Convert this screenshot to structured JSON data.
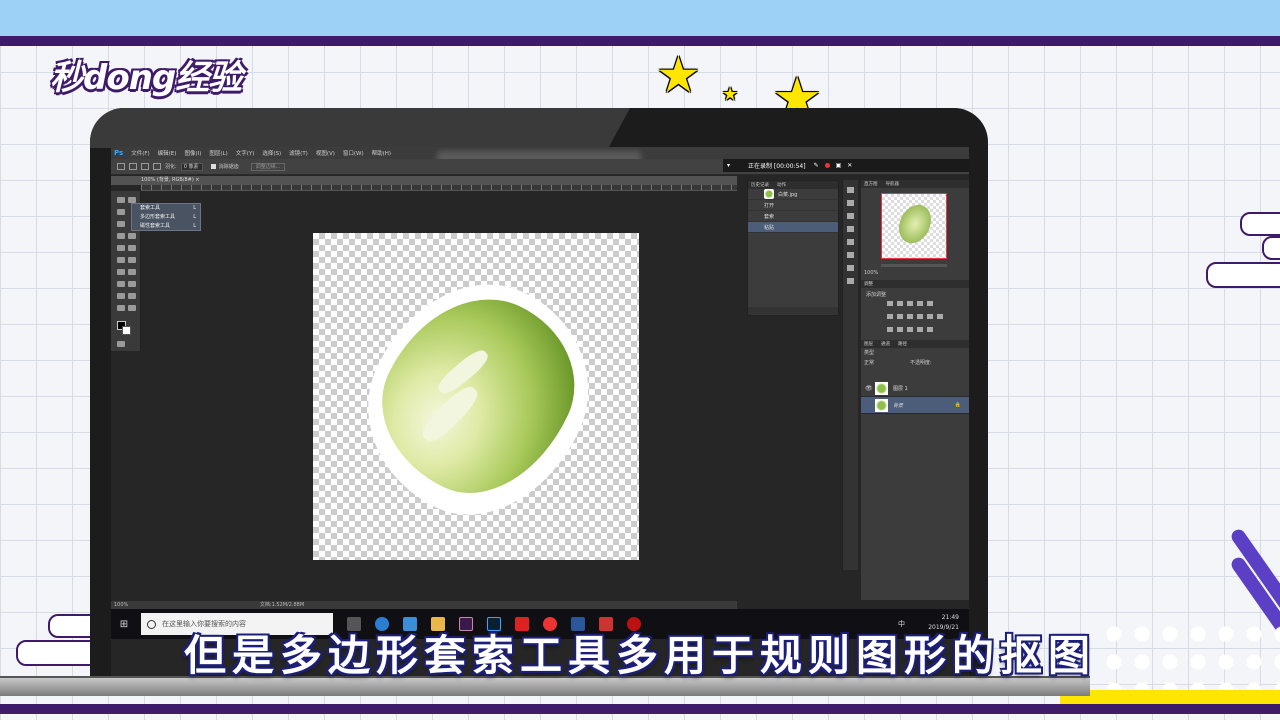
{
  "watermark": {
    "logo_text": "秒dong经验"
  },
  "photoshop": {
    "app_logo": "Ps",
    "menu": [
      "文件(F)",
      "编辑(E)",
      "图像(I)",
      "图层(L)",
      "文字(Y)",
      "选择(S)",
      "滤镜(T)",
      "视图(V)",
      "窗口(W)",
      "帮助(H)"
    ],
    "options": {
      "feather_label": "羽化:",
      "feather_value": "0 像素",
      "antialias_label": "消除锯齿",
      "refine_edge_label": "调整边缘..."
    },
    "recording": {
      "status": "正在录制 [00:00:54]",
      "rec_color": "#e33333"
    },
    "document_tab": "100% (背景, RGB/8#) ×",
    "tool_flyout": [
      {
        "label": "套索工具",
        "key": "L"
      },
      {
        "label": "多边形套索工具",
        "key": "L"
      },
      {
        "label": "磁性套索工具",
        "key": "L"
      }
    ],
    "history_panel": {
      "tabs": [
        "历史记录",
        "动作"
      ],
      "snapshot": "白菜.jpg",
      "items": [
        "打开",
        "套索",
        "粘贴"
      ],
      "selected_index": 2
    },
    "navigator_panel": {
      "tabs": [
        "直方图",
        "导航器"
      ],
      "zoom": "100%"
    },
    "adjustments_panel": {
      "tabs": [
        "调整"
      ],
      "title": "添加调整"
    },
    "layers_panel": {
      "tabs": [
        "图层",
        "通道",
        "路径"
      ],
      "filter_kind": "类型",
      "blend_mode": "正常",
      "opacity_label": "不透明度:",
      "layers": [
        {
          "name": "图层 1",
          "selected": false,
          "visible": true
        },
        {
          "name": "背景",
          "selected": true,
          "visible": false
        }
      ]
    },
    "status_bar": {
      "zoom": "100%",
      "doc_size": "文档:1.52M/2.88M"
    }
  },
  "taskbar": {
    "search_placeholder": "在这里输入你要搜索的内容",
    "time": "21:49",
    "date": "2019/9/21",
    "input_lang": "中"
  },
  "subtitle": "但是多边形套索工具多用于规则图形的抠图",
  "colors": {
    "accent_purple": "#3e1b6a",
    "top_band": "#9dd2f6",
    "star_yellow": "#ffe600",
    "selection_blue": "#4b5d79"
  }
}
